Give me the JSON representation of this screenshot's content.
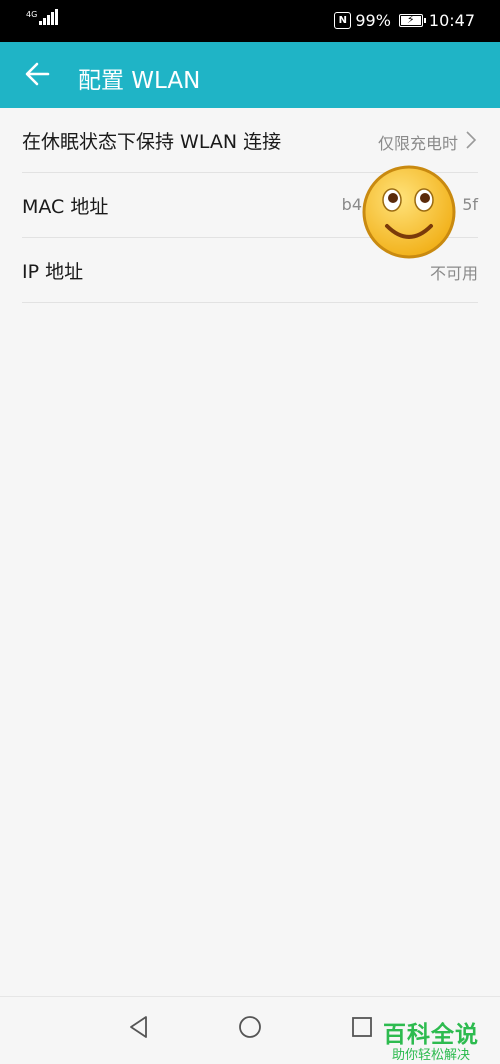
{
  "status_bar": {
    "network": "4G",
    "battery_percent": "99%",
    "time": "10:47"
  },
  "header": {
    "title": "配置 WLAN"
  },
  "settings": [
    {
      "label": "在休眠状态下保持 WLAN 连接",
      "value": "仅限充电时"
    },
    {
      "label": "MAC 地址",
      "value_left": "b4",
      "value_right": "5f"
    },
    {
      "label": "IP 地址",
      "value": "不可用"
    }
  ],
  "watermark": {
    "title": "百科全说",
    "subtitle": "助你轻松解决"
  },
  "colors": {
    "accent": "#1fb4c6",
    "watermark": "#2dbb4f"
  }
}
